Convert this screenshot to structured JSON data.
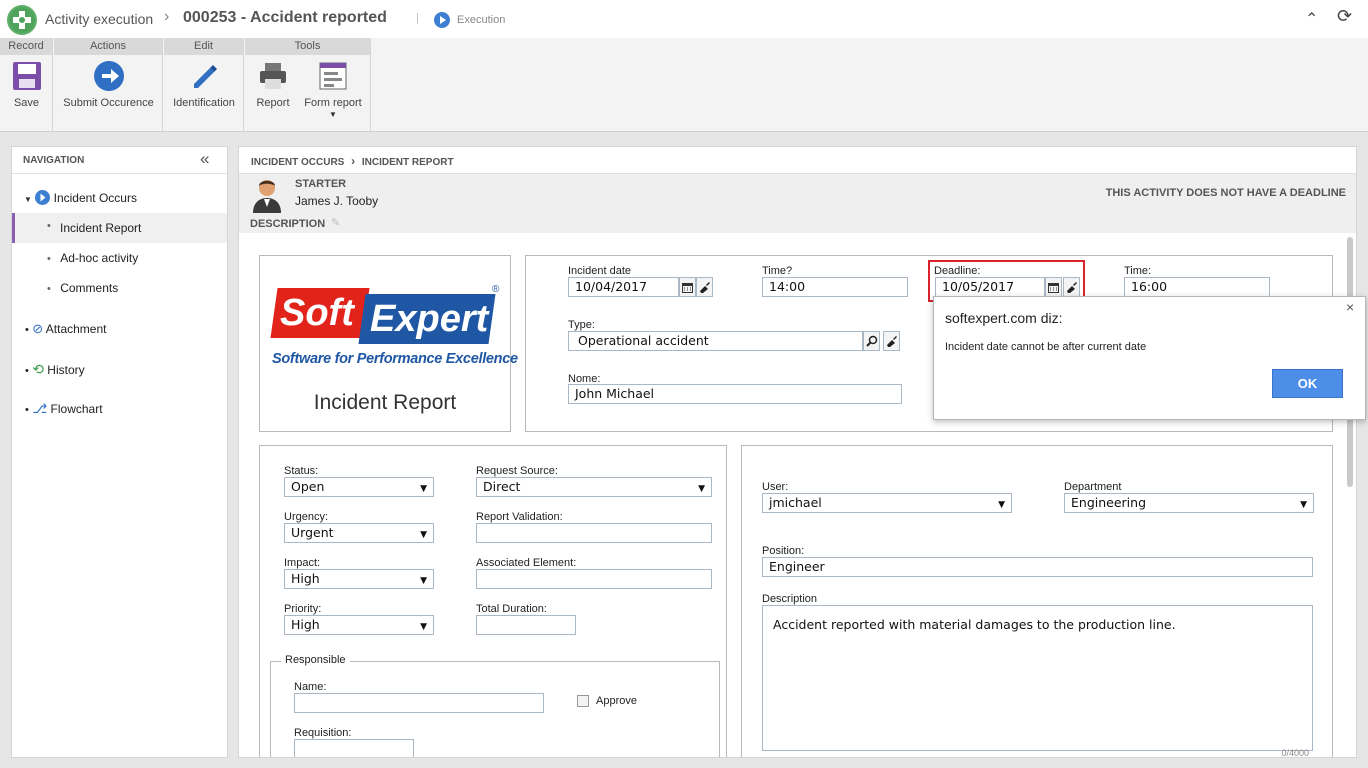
{
  "header": {
    "app_title": "Activity execution",
    "record_title": "000253 - Accident reported",
    "separator": "|",
    "status": "Execution"
  },
  "ribbon": {
    "groups": [
      {
        "label": "Record",
        "buttons": [
          "Save"
        ]
      },
      {
        "label": "Actions",
        "buttons": [
          "Submit Occurence"
        ]
      },
      {
        "label": "Edit",
        "buttons": [
          "Identification"
        ]
      },
      {
        "label": "Tools",
        "buttons": [
          "Report",
          "Form report"
        ]
      }
    ]
  },
  "navigation": {
    "title": "NAVIGATION",
    "items": [
      {
        "label": "Incident Occurs",
        "icon": "play-circle-icon"
      },
      {
        "label": "Incident Report"
      },
      {
        "label": "Ad-hoc activity"
      },
      {
        "label": "Comments"
      },
      {
        "label": "Attachment",
        "icon": "paperclip-icon"
      },
      {
        "label": "History",
        "icon": "history-icon"
      },
      {
        "label": "Flowchart",
        "icon": "flowchart-icon"
      }
    ]
  },
  "breadcrumb": {
    "items": [
      "INCIDENT OCCURS",
      "INCIDENT REPORT"
    ]
  },
  "starter": {
    "label": "STARTER",
    "name": "James J. Tooby",
    "deadline_note": "THIS ACTIVITY DOES NOT HAVE A DEADLINE"
  },
  "description_label": "DESCRIPTION",
  "logo": {
    "text_soft": "Soft",
    "text_expert": "Expert",
    "registered": "®",
    "tagline": "Software for Performance Excellence",
    "form_title": "Incident Report"
  },
  "form": {
    "incident_date": {
      "label": "Incident date",
      "value": "10/04/2017"
    },
    "time_q": {
      "label": "Time?",
      "value": "14:00"
    },
    "deadline": {
      "label": "Deadline:",
      "value": "10/05/2017"
    },
    "time2": {
      "label": "Time:",
      "value": "16:00"
    },
    "type": {
      "label": "Type:",
      "value": "Operational accident"
    },
    "nome": {
      "label": "Nome:",
      "value": "John Michael"
    },
    "status": {
      "label": "Status:",
      "value": "Open"
    },
    "request_source": {
      "label": "Request Source:",
      "value": "Direct"
    },
    "urgency": {
      "label": "Urgency:",
      "value": "Urgent"
    },
    "report_validation": {
      "label": "Report Validation:",
      "value": ""
    },
    "impact": {
      "label": "Impact:",
      "value": "High"
    },
    "associated_element": {
      "label": "Associated Element:",
      "value": ""
    },
    "priority": {
      "label": "Priority:",
      "value": "High"
    },
    "total_duration": {
      "label": "Total Duration:",
      "value": ""
    },
    "responsible": {
      "legend": "Responsible",
      "name_label": "Name:",
      "approve_label": "Approve",
      "requisition_label": "Requisition:"
    },
    "user": {
      "label": "User:",
      "value": "jmichael"
    },
    "department": {
      "label": "Department",
      "value": "Engineering"
    },
    "position": {
      "label": "Position:",
      "value": "Engineer"
    },
    "description": {
      "label": "Description",
      "value": "Accident reported with material damages to the production line.",
      "counter": "0/4000"
    }
  },
  "dialog": {
    "title": "softexpert.com diz:",
    "message": "Incident date cannot be after current date",
    "ok": "OK"
  },
  "colors": {
    "accent": "#3d7fd0",
    "highlight_border": "#d9232d",
    "nav_active_bar": "#8c5fb0",
    "logo_red": "#e2231a",
    "logo_blue": "#1f57a4"
  }
}
